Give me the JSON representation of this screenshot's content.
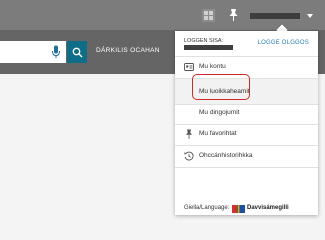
{
  "header": {
    "search_link": "DÁRKILIS OCAHAN"
  },
  "account_menu": {
    "login_label": "LOGGEN SISA:",
    "logout_label": "LOGGE OLGGOS",
    "items": [
      {
        "label": "Mu kontu",
        "icon": "id-card-icon"
      },
      {
        "label": "Mu luoikkaheamit",
        "icon": ""
      },
      {
        "label": "Mu dingojumit",
        "icon": ""
      },
      {
        "label": "Mu favorihtat",
        "icon": "pin-icon"
      },
      {
        "label": "Ohccánhistorihkka",
        "icon": "history-icon"
      }
    ],
    "language_label": "Giella/Language:",
    "language_value": "Davvisámegilli"
  },
  "colors": {
    "header_bg": "#7c7c7c",
    "search_bg": "#656565",
    "search_button": "#0e6d87",
    "link": "#2a7fb5",
    "highlight_border": "#cf2a2a"
  }
}
